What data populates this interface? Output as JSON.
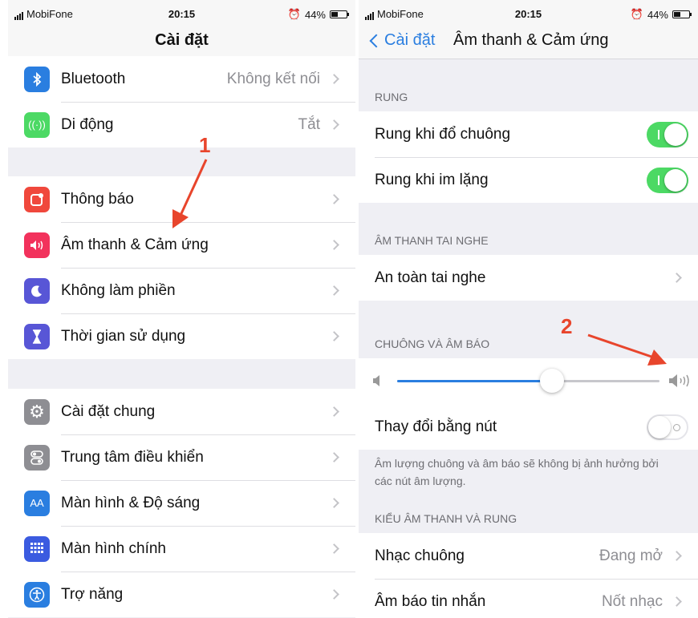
{
  "left": {
    "status": {
      "carrier": "MobiFone",
      "time": "20:15",
      "battery": "44%",
      "battery_level": 0.44
    },
    "nav_title": "Cài đặt",
    "group1": [
      {
        "name": "bluetooth",
        "label": "Bluetooth",
        "value": "Không kết nối",
        "icon": "bluetooth-icon",
        "color": "#2a7ee0"
      },
      {
        "name": "cellular",
        "label": "Di động",
        "value": "Tắt",
        "icon": "antenna-icon",
        "color": "#4cd964"
      }
    ],
    "group2": [
      {
        "name": "notifications",
        "label": "Thông báo",
        "icon": "notification-icon",
        "color": "#f0483c"
      },
      {
        "name": "sounds",
        "label": "Âm thanh & Cảm ứng",
        "icon": "speaker-icon",
        "color": "#f2325c"
      },
      {
        "name": "do-not-disturb",
        "label": "Không làm phiền",
        "icon": "moon-icon",
        "color": "#5856d6"
      },
      {
        "name": "screen-time",
        "label": "Thời gian sử dụng",
        "icon": "hourglass-icon",
        "color": "#5856d6"
      }
    ],
    "group3": [
      {
        "name": "general",
        "label": "Cài đặt chung",
        "icon": "gear-icon",
        "color": "#8e8e93"
      },
      {
        "name": "control-center",
        "label": "Trung tâm điều khiển",
        "icon": "switches-icon",
        "color": "#8e8e93"
      },
      {
        "name": "display",
        "label": "Màn hình & Độ sáng",
        "icon": "aa-icon",
        "color": "#2a7ee0"
      },
      {
        "name": "home-screen",
        "label": "Màn hình chính",
        "icon": "grid-icon",
        "color": "#3b5be0"
      },
      {
        "name": "accessibility",
        "label": "Trợ năng",
        "icon": "accessibility-icon",
        "color": "#2a7ee0"
      }
    ],
    "annotation": "1"
  },
  "right": {
    "status": {
      "carrier": "MobiFone",
      "time": "20:15",
      "battery": "44%",
      "battery_level": 0.44
    },
    "back_label": "Cài đặt",
    "nav_title": "Âm thanh & Cảm ứng",
    "vibrate_header": "RUNG",
    "vibrate_on_ring": {
      "label": "Rung khi đổ chuông",
      "on": true
    },
    "vibrate_on_silent": {
      "label": "Rung khi im lặng",
      "on": true
    },
    "headphone_header": "ÂM THANH TAI NGHE",
    "headphone_safety": "An toàn tai nghe",
    "ringer_header": "CHUÔNG VÀ ÂM BÁO",
    "ringer_volume": 0.59,
    "change_with_buttons": {
      "label": "Thay đổi bằng nút",
      "on": false
    },
    "ringer_footnote": "Âm lượng chuông và âm báo sẽ không bị ảnh hưởng bởi các nút âm lượng.",
    "patterns_header": "KIỂU ÂM THANH VÀ RUNG",
    "ringtone": {
      "label": "Nhạc chuông",
      "value": "Đang mở"
    },
    "text_tone": {
      "label": "Âm báo tin nhắn",
      "value": "Nốt nhạc"
    },
    "annotation": "2"
  },
  "colors": {
    "accent": "#2a7ee0",
    "toggle_on": "#4cd964",
    "annotation": "#e8452c"
  }
}
